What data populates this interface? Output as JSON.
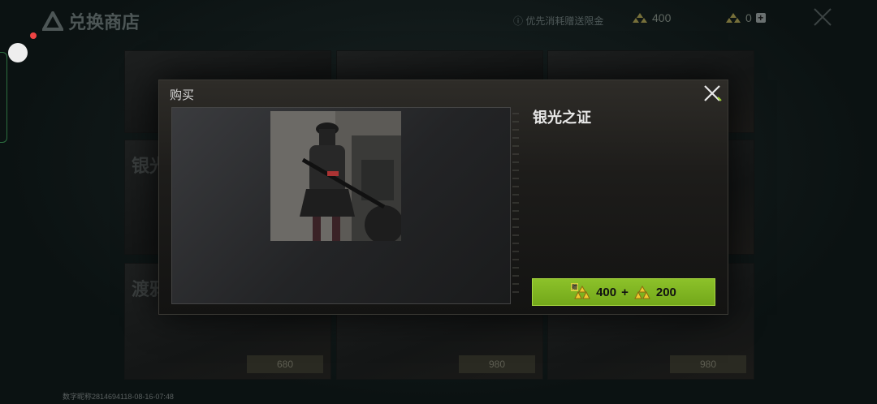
{
  "store": {
    "title": "兑换商店",
    "notice": "优先消耗赠送限金",
    "currency_gift_value": "400",
    "currency_main_value": "0",
    "plus_label": "+",
    "footer_id": "数字昵称2814694118-08-16-07:48"
  },
  "cards": [
    {
      "title": "",
      "price": ""
    },
    {
      "title": "",
      "price": ""
    },
    {
      "title": "",
      "price": ""
    },
    {
      "title": "银光",
      "price": ""
    },
    {
      "title": "",
      "price": ""
    },
    {
      "title": "",
      "price": ""
    },
    {
      "title": "渡鸦",
      "price": "680"
    },
    {
      "title": "",
      "price": "980"
    },
    {
      "title": "",
      "price": "980"
    }
  ],
  "modal": {
    "title": "购买",
    "item_name": "银光之证",
    "price_gift": "400",
    "price_plus": "+",
    "price_main": "200",
    "gift_tag": "赠"
  },
  "colors": {
    "accent": "#8cc12a",
    "gold": "#d8b020"
  }
}
